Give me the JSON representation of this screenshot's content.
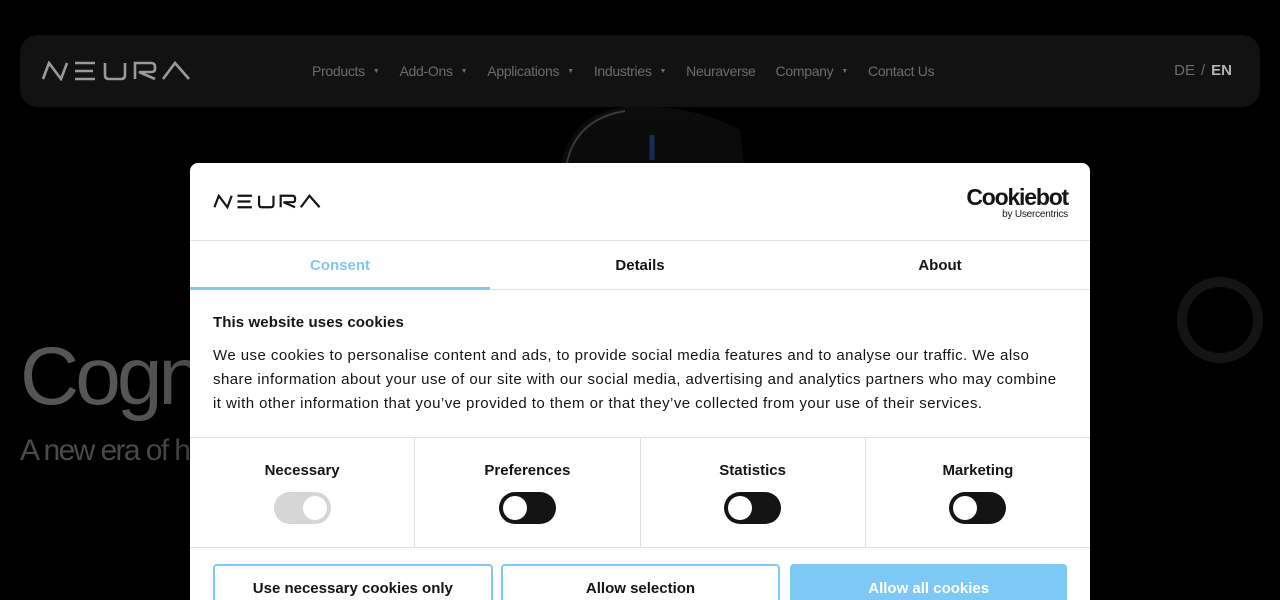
{
  "header": {
    "nav": [
      {
        "label": "Products",
        "has_caret": true
      },
      {
        "label": "Add-Ons",
        "has_caret": true
      },
      {
        "label": "Applications",
        "has_caret": true
      },
      {
        "label": "Industries",
        "has_caret": true
      },
      {
        "label": "Neuraverse",
        "has_caret": false
      },
      {
        "label": "Company",
        "has_caret": true
      },
      {
        "label": "Contact Us",
        "has_caret": false
      }
    ],
    "lang": {
      "de": "DE",
      "sep": "/",
      "en": "EN",
      "active": "EN"
    }
  },
  "hero": {
    "title": "Cogn",
    "subtitle": "A new era of h"
  },
  "cookie_dialog": {
    "provider": {
      "name": "Cookiebot",
      "byline": "by Usercentrics"
    },
    "tabs": [
      {
        "label": "Consent",
        "active": true
      },
      {
        "label": "Details",
        "active": false
      },
      {
        "label": "About",
        "active": false
      }
    ],
    "heading": "This website uses cookies",
    "body": "We use cookies to personalise content and ads, to provide social media features and to analyse our traffic. We also share information about your use of our site with our social media, advertising and analytics partners who may combine it with other information that you’ve provided to them or that they’ve collected from your use of their services.",
    "toggles": [
      {
        "label": "Necessary",
        "checked": true,
        "disabled": true
      },
      {
        "label": "Preferences",
        "checked": false,
        "disabled": false
      },
      {
        "label": "Statistics",
        "checked": false,
        "disabled": false
      },
      {
        "label": "Marketing",
        "checked": false,
        "disabled": false
      }
    ],
    "buttons": {
      "necessary_only": "Use necessary cookies only",
      "allow_selection": "Allow selection",
      "allow_all": "Allow all cookies"
    }
  },
  "colors": {
    "accent": "#7ec8f5",
    "text": "#141414",
    "background": "#000000",
    "header_bg": "#121212"
  }
}
